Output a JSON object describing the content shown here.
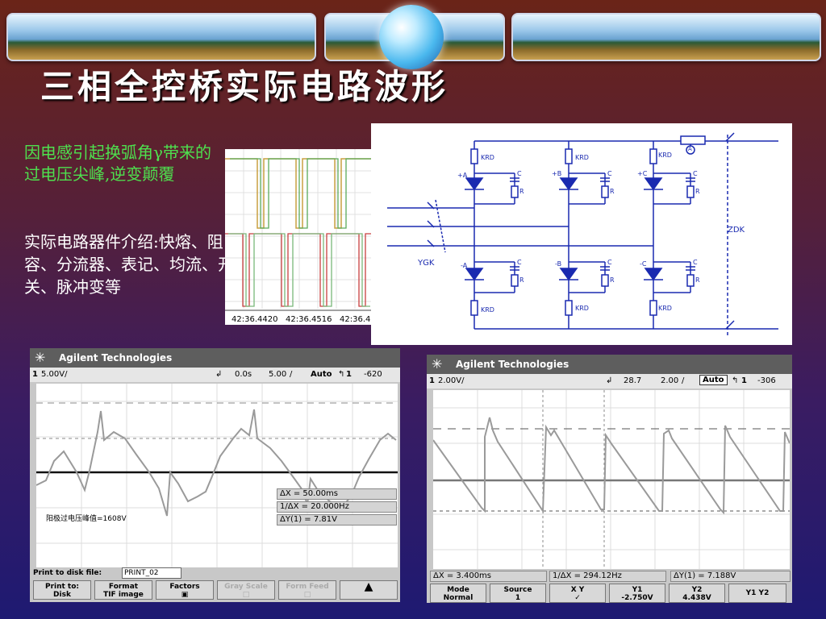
{
  "slide": {
    "title": "三相全控桥实际电路波形",
    "green_text": "因电感引起换弧角γ带来的过电压尖峰,逆变颠覆",
    "white_text": "实际电路器件介绍:快熔、阻容、分流器、表记、均流、开关、脉冲变等"
  },
  "wave_photo": {
    "timestamps": [
      "42:36.4420",
      "42:36.4516",
      "42:36.4"
    ]
  },
  "circuit": {
    "labels": {
      "krd": "KRD",
      "c": "C",
      "r": "R",
      "a_pos": "+A",
      "b_pos": "+B",
      "c_pos": "+C",
      "a_neg": "-A",
      "b_neg": "-B",
      "c_neg": "-C",
      "ygk": "YGK",
      "zdk": "ZDK",
      "ammeter": "A"
    }
  },
  "scope_left": {
    "brand": "Agilent Technologies",
    "ch": "1",
    "volts_div": "5.00V/",
    "time_offset": "0.0s",
    "time_div": "5.00",
    "time_div_unit": "/",
    "mode": "Auto",
    "trigger": "1",
    "trigger_level": "-620",
    "measurements": [
      "ΔX = 50.00ms",
      "1/ΔX = 20.000Hz",
      "ΔY(1) = 7.81V"
    ],
    "annotation": "阳极过电压峰值=1608V",
    "print_label": "Print to disk file:",
    "print_file": "PRINT_02",
    "softkeys": [
      {
        "line1": "Print to:",
        "line2": "Disk"
      },
      {
        "line1": "Format",
        "line2": "TIF image"
      },
      {
        "line1": "Factors",
        "line2": ""
      },
      {
        "line1": "Gray Scale",
        "line2": ""
      },
      {
        "line1": "Form Feed",
        "line2": ""
      },
      {
        "line1": "",
        "line2": ""
      }
    ]
  },
  "scope_right": {
    "brand": "Agilent Technologies",
    "ch": "1",
    "volts_div": "2.00V/",
    "time_offset": "28.7",
    "time_div": "2.00",
    "time_div_unit": "/",
    "mode": "Auto",
    "trigger": "1",
    "trigger_level": "-306",
    "measurements": [
      "ΔX = 3.400ms",
      "1/ΔX = 294.12Hz",
      "ΔY(1) = 7.188V"
    ],
    "softkeys": [
      {
        "line1": "Mode",
        "line2": "Normal"
      },
      {
        "line1": "Source",
        "line2": "1"
      },
      {
        "line1": "X      Y",
        "line2": ""
      },
      {
        "line1": "Y1",
        "line2": "-2.750V"
      },
      {
        "line1": "Y2",
        "line2": "4.438V"
      },
      {
        "line1": "Y1  Y2",
        "line2": ""
      }
    ]
  },
  "colors": {
    "green_text": "#4ee04e",
    "title": "#ffffff",
    "trace": "#9a9a9a"
  }
}
